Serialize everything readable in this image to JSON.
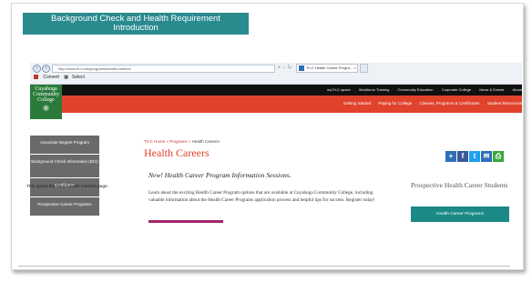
{
  "slide": {
    "title_line1": "Background Check and Health Requirement",
    "title_line2": "Introduction",
    "caption": "This opens the Tri-C Health Careers page."
  },
  "browser": {
    "address": "http://www.tri-c.edu/programs/health-careers/",
    "addr_icons": "⌕ → ↻",
    "tab_label": "Tri-C Health Career Progra...",
    "tab_close": "×",
    "toolbar": [
      "Convert",
      "Select"
    ]
  },
  "site": {
    "logo": [
      "Cuyahoga",
      "Community",
      "College"
    ],
    "top_nav": [
      "myTri-C space",
      "Workforce Training",
      "Community Education",
      "Corporate College",
      "News & Events",
      "About"
    ],
    "main_nav": [
      "Getting Started",
      "Paying for College",
      "Classes, Programs & Certificates",
      "Student Resources"
    ],
    "sidebar": [
      "Associate Degree Program",
      "Background Check Information (BCI)",
      "Certificates",
      "Prospective Career Programs"
    ],
    "breadcrumb": {
      "home": "Tri-C Home",
      "sep1": " » ",
      "programs": "Programs",
      "sep2": " » ",
      "current": "Health Careers"
    },
    "page_title": "Health Careers",
    "subheading": "New! Health Career Program Information Sessions.",
    "intro": "Learn about the exciting Health Career Program options that are available at Cuyahoga Community College, including valuable information about the Health Career Programs application process and helpful tips for success. Register today!",
    "prospect_heading": "Prospective Health Career Students",
    "prospect_button": "Health Career Programs",
    "share": [
      {
        "icon": "plus-icon",
        "glyph": "+",
        "color": "#2d6fb7"
      },
      {
        "icon": "facebook-icon",
        "glyph": "f",
        "color": "#3b5998"
      },
      {
        "icon": "twitter-icon",
        "glyph": "t",
        "color": "#1da1f2"
      },
      {
        "icon": "email-icon",
        "glyph": "✉",
        "color": "#2d6fb7"
      },
      {
        "icon": "print-icon",
        "glyph": "⎙",
        "color": "#3aa93a"
      }
    ]
  },
  "colors": {
    "teal": "#2a8b8f",
    "red": "#e0422c",
    "green": "#2a7b3a",
    "magenta": "#a1276b",
    "sidebar": "#6a6a6a"
  }
}
